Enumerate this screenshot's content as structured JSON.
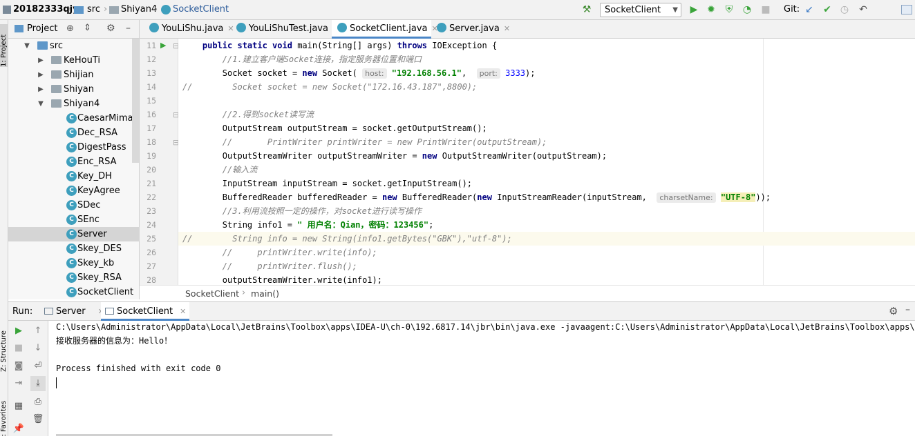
{
  "navbar": {
    "project": "20182333qjy",
    "crumbs": [
      "src",
      "Shiyan4",
      "SocketClient"
    ],
    "run_config": "SocketClient",
    "git_label": "Git:"
  },
  "left_strip": {
    "project_label": "1: Project",
    "structure_label": "Z: Structure",
    "favorites_label": "2: Favorites"
  },
  "project_panel": {
    "title": "Project",
    "tree": [
      {
        "label": "src",
        "depth": 1,
        "kind": "folder-src",
        "expanded": true
      },
      {
        "label": "KeHouTi",
        "depth": 2,
        "kind": "folder",
        "expanded": false
      },
      {
        "label": "Shijian",
        "depth": 2,
        "kind": "folder",
        "expanded": false
      },
      {
        "label": "Shiyan",
        "depth": 2,
        "kind": "folder",
        "expanded": false
      },
      {
        "label": "Shiyan4",
        "depth": 2,
        "kind": "folder",
        "expanded": true
      },
      {
        "label": "CaesarMima",
        "depth": 3,
        "kind": "class"
      },
      {
        "label": "Dec_RSA",
        "depth": 3,
        "kind": "class"
      },
      {
        "label": "DigestPass",
        "depth": 3,
        "kind": "class"
      },
      {
        "label": "Enc_RSA",
        "depth": 3,
        "kind": "class"
      },
      {
        "label": "Key_DH",
        "depth": 3,
        "kind": "class"
      },
      {
        "label": "KeyAgree",
        "depth": 3,
        "kind": "class"
      },
      {
        "label": "SDec",
        "depth": 3,
        "kind": "class"
      },
      {
        "label": "SEnc",
        "depth": 3,
        "kind": "class"
      },
      {
        "label": "Server",
        "depth": 3,
        "kind": "class",
        "selected": true
      },
      {
        "label": "Skey_DES",
        "depth": 3,
        "kind": "class"
      },
      {
        "label": "Skey_kb",
        "depth": 3,
        "kind": "class"
      },
      {
        "label": "Skey_RSA",
        "depth": 3,
        "kind": "class"
      },
      {
        "label": "SocketClient",
        "depth": 3,
        "kind": "class"
      }
    ]
  },
  "editor_tabs": [
    {
      "label": "YouLiShu.java",
      "active": false
    },
    {
      "label": "YouLiShuTest.java",
      "active": false
    },
    {
      "label": "SocketClient.java",
      "active": true
    },
    {
      "label": "Server.java",
      "active": false
    }
  ],
  "code": {
    "lines": [
      {
        "n": "11",
        "parts": [
          {
            "t": "    "
          },
          {
            "c": "kw",
            "t": "public static void "
          },
          {
            "t": "main(String[] args) "
          },
          {
            "c": "kw",
            "t": "throws "
          },
          {
            "t": "IOException {"
          }
        ]
      },
      {
        "n": "12",
        "parts": [
          {
            "t": "        "
          },
          {
            "c": "cm",
            "t": "//1.建立客户端Socket连接，指定服务器位置和端口"
          }
        ]
      },
      {
        "n": "13",
        "parts": [
          {
            "t": "        Socket socket = "
          },
          {
            "c": "kw",
            "t": "new "
          },
          {
            "t": "Socket( "
          },
          {
            "c": "hint",
            "t": "host:"
          },
          {
            "t": " "
          },
          {
            "c": "str",
            "t": "\"192.168.56.1\""
          },
          {
            "t": ",  "
          },
          {
            "c": "hint",
            "t": "port:"
          },
          {
            "t": " "
          },
          {
            "c": "num",
            "t": "3333"
          },
          {
            "t": ");"
          }
        ]
      },
      {
        "n": "14",
        "parts": [
          {
            "c": "cm",
            "t": "//        Socket socket = new Socket(\"172.16.43.187\",8800);"
          }
        ]
      },
      {
        "n": "15",
        "parts": [
          {
            "t": ""
          }
        ]
      },
      {
        "n": "16",
        "parts": [
          {
            "t": "        "
          },
          {
            "c": "cm",
            "t": "//2.得到socket读写流"
          }
        ]
      },
      {
        "n": "17",
        "parts": [
          {
            "t": "        OutputStream outputStream = socket.getOutputStream();"
          }
        ]
      },
      {
        "n": "18",
        "parts": [
          {
            "t": "        "
          },
          {
            "c": "cm",
            "t": "//       PrintWriter printWriter = new PrintWriter(outputStream);"
          }
        ]
      },
      {
        "n": "19",
        "parts": [
          {
            "t": "        OutputStreamWriter outputStreamWriter = "
          },
          {
            "c": "kw",
            "t": "new "
          },
          {
            "t": "OutputStreamWriter(outputStream);"
          }
        ]
      },
      {
        "n": "20",
        "parts": [
          {
            "t": "        "
          },
          {
            "c": "cm",
            "t": "//输入流"
          }
        ]
      },
      {
        "n": "21",
        "parts": [
          {
            "t": "        InputStream inputStream = socket.getInputStream();"
          }
        ]
      },
      {
        "n": "22",
        "parts": [
          {
            "t": "        BufferedReader bufferedReader = "
          },
          {
            "c": "kw",
            "t": "new "
          },
          {
            "t": "BufferedReader("
          },
          {
            "c": "kw",
            "t": "new "
          },
          {
            "t": "InputStreamReader(inputStream,  "
          },
          {
            "c": "hint",
            "t": "charsetName:"
          },
          {
            "t": " "
          },
          {
            "c": "str utf",
            "t": "\"UTF-8\""
          },
          {
            "t": "));"
          }
        ]
      },
      {
        "n": "23",
        "parts": [
          {
            "t": "        "
          },
          {
            "c": "cm",
            "t": "//3.利用流按照一定的操作，对socket进行读写操作"
          }
        ]
      },
      {
        "n": "24",
        "parts": [
          {
            "t": "        String info1 = "
          },
          {
            "c": "str",
            "t": "\" 用户名：Qian，密码：123456\""
          },
          {
            "t": ";"
          }
        ]
      },
      {
        "n": "25",
        "parts": [
          {
            "c": "cm",
            "t": "//        String info = new String(info1.getBytes(\"GBK\"),\"utf-8\");"
          }
        ],
        "highlight": true
      },
      {
        "n": "26",
        "parts": [
          {
            "t": "        "
          },
          {
            "c": "cm",
            "t": "//     printWriter.write(info);"
          }
        ]
      },
      {
        "n": "27",
        "parts": [
          {
            "t": "        "
          },
          {
            "c": "cm",
            "t": "//     printWriter.flush();"
          }
        ]
      },
      {
        "n": "28",
        "parts": [
          {
            "t": "        outputStreamWriter.write(info1);"
          }
        ]
      }
    ]
  },
  "breadcrumb": {
    "cls": "SocketClient",
    "method": "main()"
  },
  "run": {
    "label": "Run:",
    "tabs": [
      {
        "label": "Server",
        "active": false
      },
      {
        "label": "SocketClient",
        "active": true
      }
    ],
    "console": [
      "C:\\Users\\Administrator\\AppData\\Local\\JetBrains\\Toolbox\\apps\\IDEA-U\\ch-0\\192.6817.14\\jbr\\bin\\java.exe -javaagent:C:\\Users\\Administrator\\AppData\\Local\\JetBrains\\Toolbox\\apps\\IDEA-U",
      "接收服务器的信息为：Hello！",
      "",
      "Process finished with exit code 0"
    ]
  }
}
